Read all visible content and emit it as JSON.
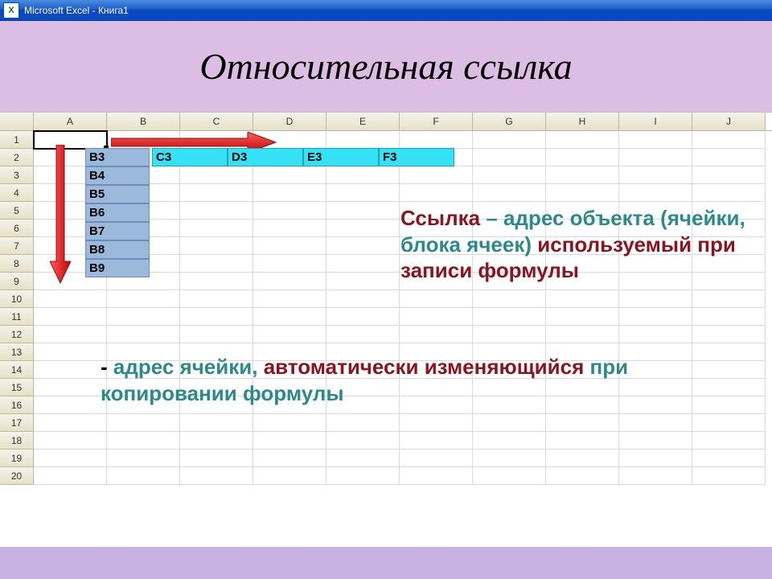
{
  "titlebar": {
    "app_title": "Microsoft Excel - Книга1",
    "icon_letter": "X"
  },
  "heading": "Относительная ссылка",
  "columns": [
    "A",
    "B",
    "C",
    "D",
    "E",
    "F",
    "G",
    "H",
    "I",
    "J"
  ],
  "rows": [
    "1",
    "2",
    "3",
    "4",
    "5",
    "6",
    "7",
    "8",
    "9",
    "10",
    "11",
    "12",
    "13",
    "14",
    "15",
    "16",
    "17",
    "18",
    "19",
    "20"
  ],
  "b_column_cells": [
    "B3",
    "B4",
    "B5",
    "B6",
    "B7",
    "B8",
    "B9"
  ],
  "row3_cells": [
    "C3",
    "D3",
    "E3",
    "F3"
  ],
  "text_block_right": {
    "w1": "Ссылка",
    "w2": " – адрес объекта (ячейки, блока ячеек)",
    "w3": " используемый при записи формулы"
  },
  "text_block_bottom": {
    "dash": "- ",
    "w1": "адрес ячейки, ",
    "w2": "автоматически изменяющийся",
    "w3": " при копировании формулы"
  }
}
